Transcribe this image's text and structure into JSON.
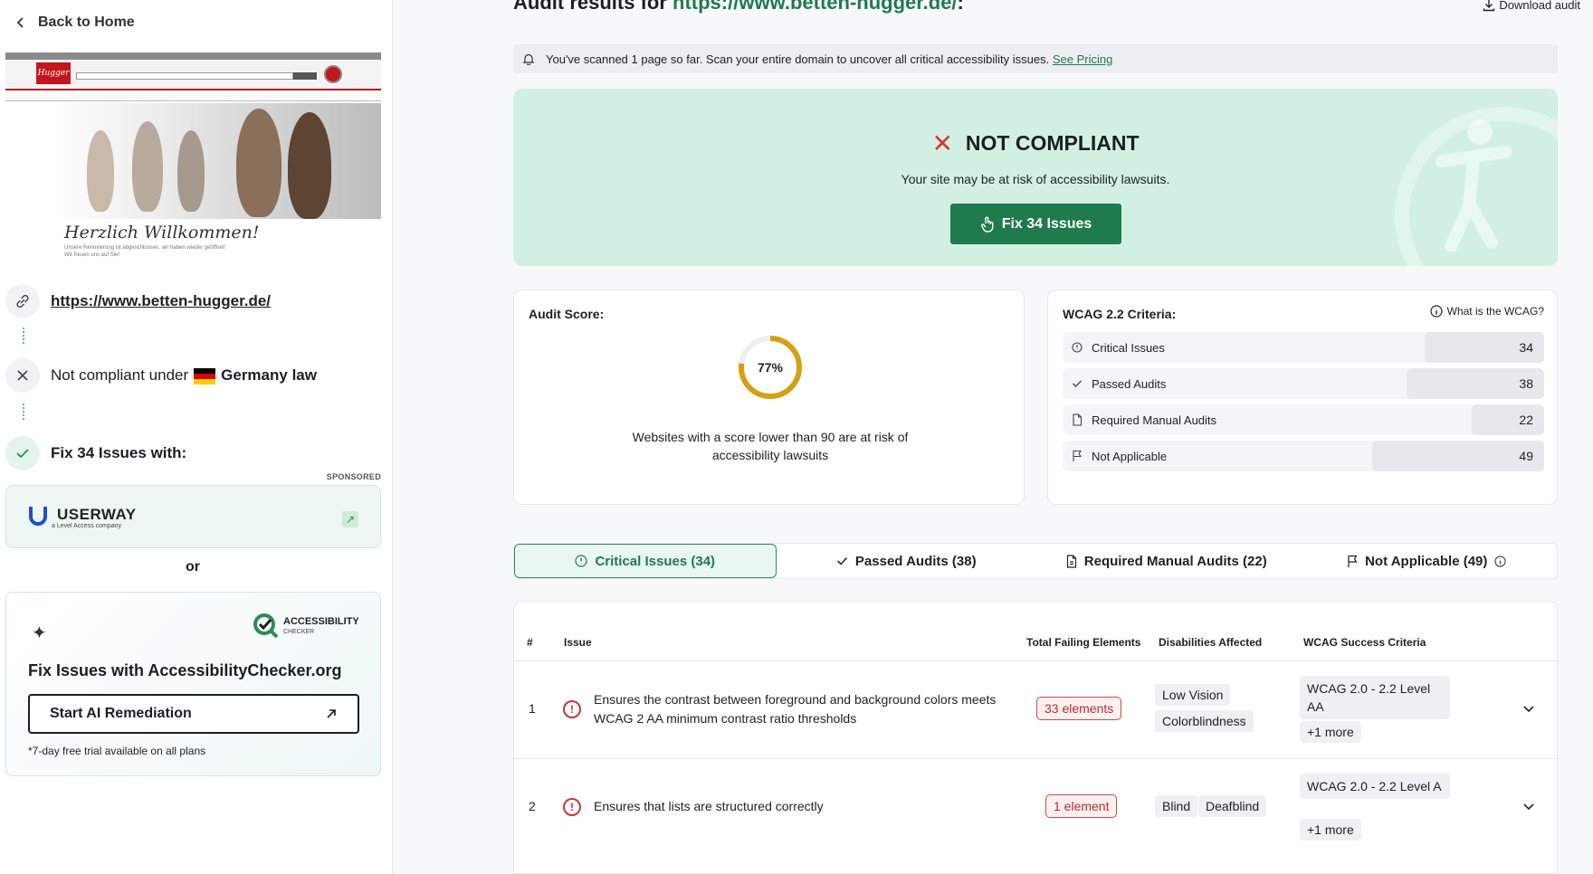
{
  "sidebar": {
    "back_label": "Back to Home",
    "preview": {
      "logo_text": "Hugger",
      "welcome": "Herzlich Willkommen!",
      "welcome_sub": "Unsere Renovierung ist abgeschlossen, wir haben wieder geöffnet!",
      "welcome_sub2": "Wir freuen uns auf Sie!"
    },
    "url": "https://www.betten-hugger.de/",
    "compliance_prefix": "Not compliant under",
    "compliance_law": "Germany law",
    "fix_label": "Fix 34 Issues with:",
    "sponsored": "SPONSORED",
    "userway_name": "USERWAY",
    "userway_sub": "a Level Access company",
    "or_label": "or",
    "ac_brand": "ACCESSIBILITY",
    "ac_brand_sub": "CHECKER",
    "ac_title": "Fix Issues with AccessibilityChecker.org",
    "ac_button": "Start AI Remediation",
    "ac_note": "*7-day free trial available on all plans"
  },
  "header": {
    "title_prefix": "Audit results for",
    "title_url": "https://www.betten-hugger.de/",
    "title_suffix": ":",
    "download_label": "Download audit"
  },
  "notice": {
    "text": "You've scanned 1 page so far. Scan your entire domain to uncover all critical accessibility issues.",
    "link": "See Pricing"
  },
  "banner": {
    "status": "NOT COMPLIANT",
    "risk": "Your site may be at risk of accessibility lawsuits.",
    "fix_button": "Fix 34 Issues"
  },
  "score": {
    "label": "Audit Score:",
    "value": 77,
    "value_text": "77%",
    "description": "Websites with a score lower than 90 are at risk of accessibility lawsuits",
    "color": "#d4a017"
  },
  "wcag": {
    "label": "WCAG 2.2 Criteria:",
    "what_link": "What is the WCAG?",
    "items": [
      {
        "label": "Critical Issues",
        "value": "34",
        "icon": "alert-circle-icon"
      },
      {
        "label": "Passed Audits",
        "value": "38",
        "icon": "check-icon"
      },
      {
        "label": "Required Manual Audits",
        "value": "22",
        "icon": "document-icon"
      },
      {
        "label": "Not Applicable",
        "value": "49",
        "icon": "flag-icon"
      }
    ]
  },
  "tabs": [
    {
      "label": "Critical Issues (34)",
      "icon": "alert-circle-icon",
      "active": true
    },
    {
      "label": "Passed Audits (38)",
      "icon": "check-icon",
      "active": false
    },
    {
      "label": "Required Manual Audits (22)",
      "icon": "document-icon",
      "active": false
    },
    {
      "label": "Not Applicable (49)",
      "icon": "flag-icon",
      "active": false
    }
  ],
  "table": {
    "headers": [
      "#",
      "Issue",
      "Total Failing Elements",
      "Disabilities Affected",
      "WCAG Success Criteria"
    ],
    "rows": [
      {
        "index": "1",
        "issue": "Ensures the contrast between foreground and background colors meets WCAG 2 AA minimum contrast ratio thresholds",
        "elements": "33 elements",
        "disabilities": [
          "Low Vision",
          "Colorblindness"
        ],
        "criteria": "WCAG 2.0 - 2.2 Level AA",
        "more": "+1 more"
      },
      {
        "index": "2",
        "issue": "Ensures that lists are structured correctly",
        "elements": "1 element",
        "disabilities": [
          "Blind",
          "Deafblind"
        ],
        "criteria": "WCAG 2.0 - 2.2 Level A",
        "more": "+1 more"
      }
    ]
  },
  "colors": {
    "accent": "#1f7a4d",
    "danger": "#c73434",
    "banner_bg": "#d2f0e1"
  }
}
